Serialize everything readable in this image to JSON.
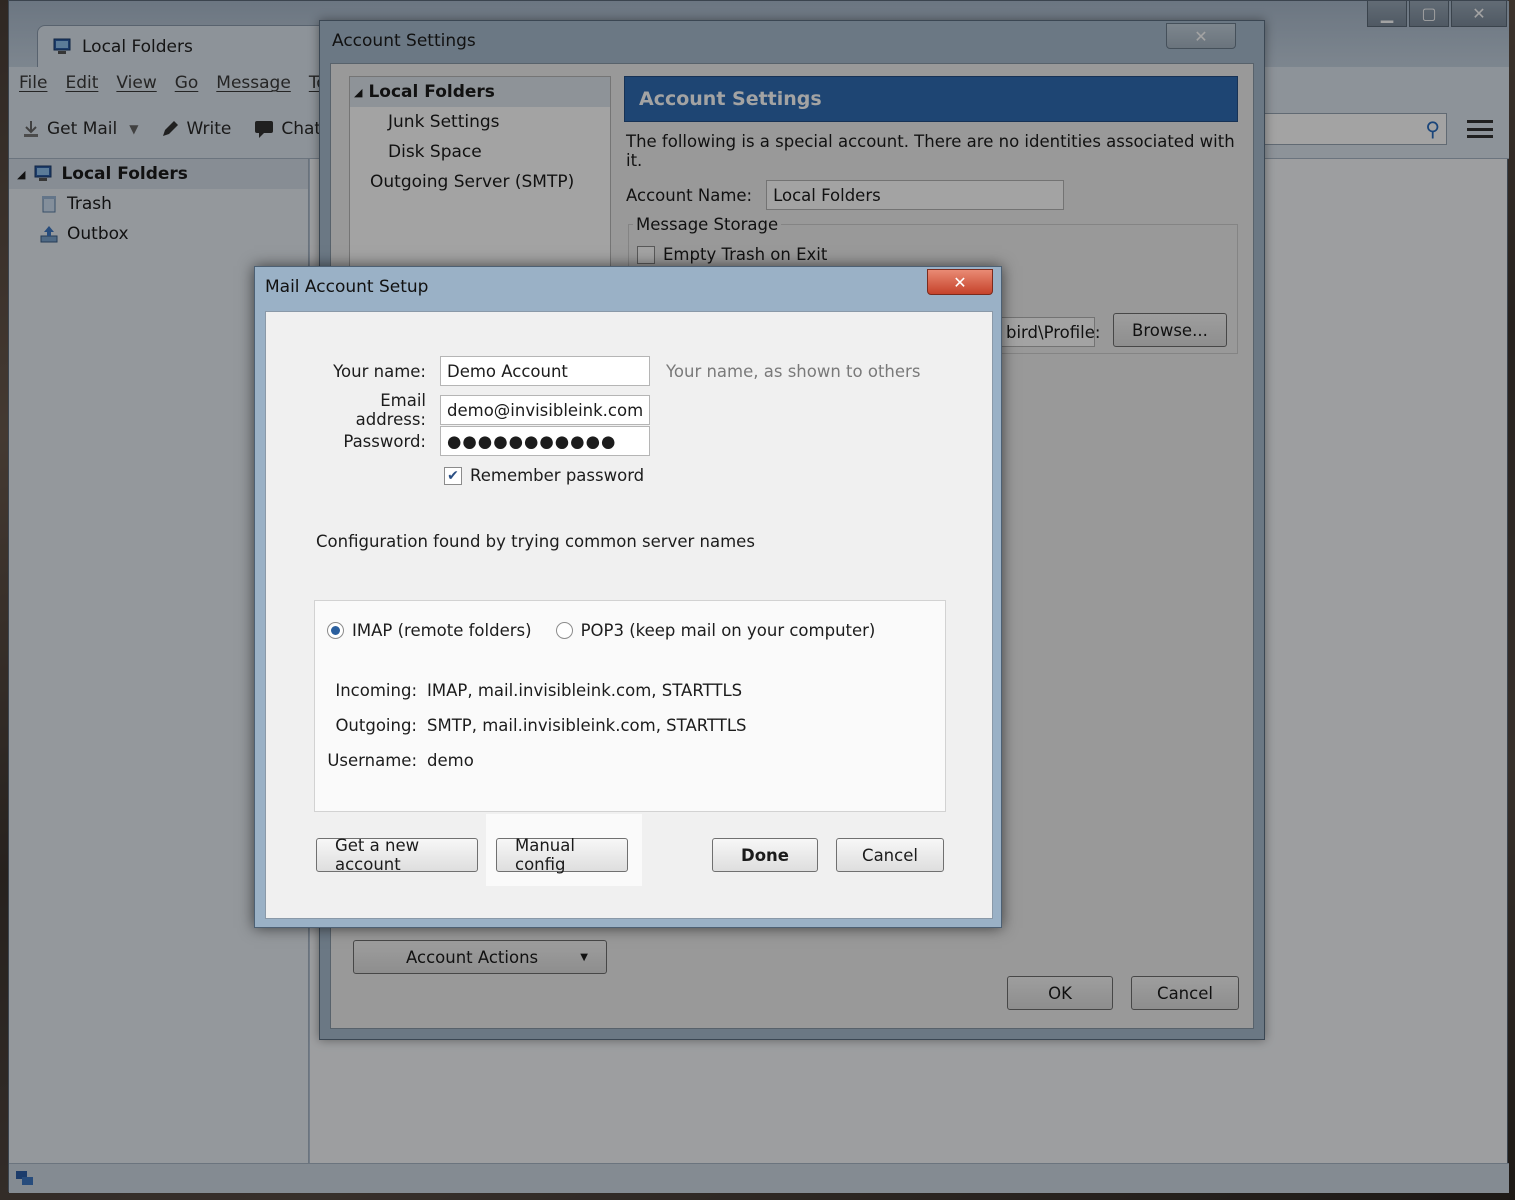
{
  "main_window": {
    "tab_label": "Local Folders",
    "menu": [
      "File",
      "Edit",
      "View",
      "Go",
      "Message",
      "Too"
    ],
    "toolbar": {
      "get_mail": "Get Mail",
      "write": "Write",
      "chat": "Chat"
    },
    "folders": {
      "root": "Local Folders",
      "children": [
        "Trash",
        "Outbox"
      ]
    }
  },
  "account_settings": {
    "window_title": "Account Settings",
    "tree": {
      "root": "Local Folders",
      "items": [
        "Junk Settings",
        "Disk Space",
        "Outgoing Server (SMTP)"
      ]
    },
    "banner": "Account Settings",
    "note": "The following is a special account. There are no identities associated with it.",
    "account_name_label": "Account Name:",
    "account_name_value": "Local Folders",
    "storage_legend": "Message Storage",
    "empty_trash_label": "Empty Trash on Exit",
    "local_directory_path": "bird\\Profile:",
    "browse_button": "Browse...",
    "account_actions": "Account Actions",
    "ok_button": "OK",
    "cancel_button": "Cancel"
  },
  "setup": {
    "title": "Mail Account Setup",
    "name_label": "Your name:",
    "name_value": "Demo Account",
    "name_hint": "Your name, as shown to others",
    "email_label": "Email address:",
    "email_value": "demo@invisibleink.com",
    "password_label": "Password:",
    "password_value": "●●●●●●●●●●●",
    "remember_label": "Remember password",
    "remember_checked": true,
    "config_message": "Configuration found by trying common server names",
    "protocol_options": [
      "IMAP (remote folders)",
      "POP3 (keep mail on your computer)"
    ],
    "selected_protocol": "IMAP (remote folders)",
    "incoming_label": "Incoming:",
    "incoming_value": "IMAP, mail.invisibleink.com, STARTTLS",
    "outgoing_label": "Outgoing:",
    "outgoing_value": "SMTP, mail.invisibleink.com, STARTTLS",
    "username_label": "Username:",
    "username_value": "demo",
    "get_account_button": "Get a new account",
    "manual_config_button": "Manual config",
    "done_button": "Done",
    "cancel_button": "Cancel"
  },
  "colors": {
    "accent": "#2f6cb4",
    "close_red": "#c6432b"
  }
}
